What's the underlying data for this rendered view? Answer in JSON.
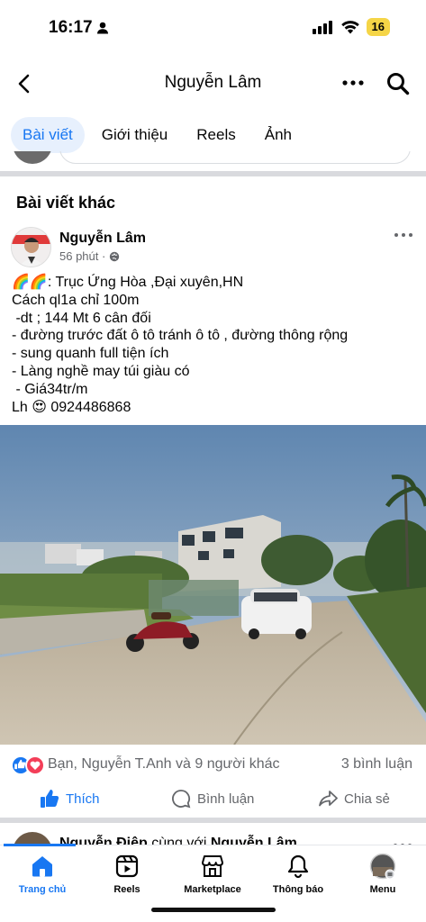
{
  "status_bar": {
    "time": "16:17",
    "battery": "16"
  },
  "header": {
    "title": "Nguyễn Lâm"
  },
  "tabs": [
    {
      "label": "Bài viết",
      "active": true
    },
    {
      "label": "Giới thiệu",
      "active": false
    },
    {
      "label": "Reels",
      "active": false
    },
    {
      "label": "Ảnh",
      "active": false
    }
  ],
  "section": {
    "title": "Bài viết khác"
  },
  "post": {
    "author": "Nguyễn Lâm",
    "time": "56 phút ·",
    "lines": [
      "🌈🌈: Trục Ứng Hòa ,Đại xuyên,HN",
      "Cách ql1a chỉ 100m",
      " -dt ; 144 Mt 6 cân đối",
      "- đường trước đất ô tô tránh ô tô , đường thông rộng",
      "- sung quanh full tiện ích",
      "- Làng nghề may túi giàu có",
      " - Giá34tr/m",
      "Lh 😍 0924486868"
    ],
    "reactions_text": "Bạn, Nguyễn T.Anh và 9 người khác",
    "comments_count": "3 bình luận",
    "like_label": "Thích",
    "comment_label": "Bình luận",
    "share_label": "Chia sẻ"
  },
  "next_post": {
    "author": "Nguyễn Điệp",
    "connector": " cùng với ",
    "with": "Nguyễn Lâm"
  },
  "bottom_nav": [
    {
      "label": "Trang chủ",
      "icon": "home-icon",
      "active": true
    },
    {
      "label": "Reels",
      "icon": "reels-icon",
      "active": false
    },
    {
      "label": "Marketplace",
      "icon": "marketplace-icon",
      "active": false
    },
    {
      "label": "Thông báo",
      "icon": "bell-icon",
      "active": false
    },
    {
      "label": "Menu",
      "icon": "profile-menu-icon",
      "active": false
    }
  ],
  "colors": {
    "accent": "#1877f2",
    "battery": "#f5d547",
    "secondary_text": "#65676b"
  }
}
